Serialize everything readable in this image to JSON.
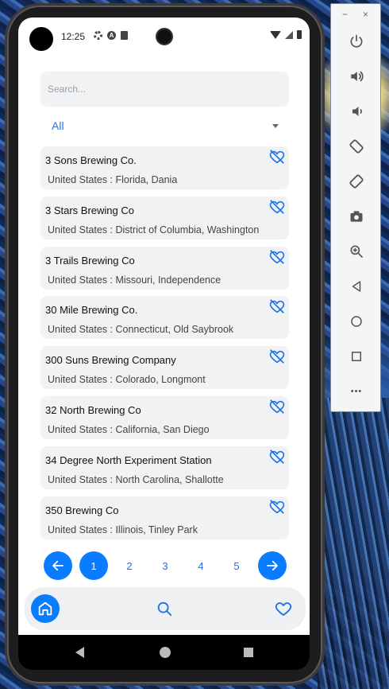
{
  "status": {
    "time": "12:25"
  },
  "search": {
    "placeholder": "Search..."
  },
  "filter": {
    "selected": "All"
  },
  "breweries": [
    {
      "name": "3 Sons Brewing Co.",
      "location": "United States : Florida, Dania"
    },
    {
      "name": "3 Stars Brewing Co",
      "location": "United States : District of Columbia, Washington"
    },
    {
      "name": "3 Trails Brewing Co",
      "location": "United States : Missouri, Independence"
    },
    {
      "name": "30 Mile Brewing Co.",
      "location": "United States : Connecticut, Old Saybrook"
    },
    {
      "name": "300 Suns Brewing Company",
      "location": "United States : Colorado, Longmont"
    },
    {
      "name": "32 North Brewing Co",
      "location": "United States : California, San Diego"
    },
    {
      "name": "34 Degree North Experiment Station",
      "location": "United States : North Carolina, Shallotte"
    },
    {
      "name": "350 Brewing Co",
      "location": "United States : Illinois, Tinley Park"
    }
  ],
  "pagination": {
    "pages": [
      "1",
      "2",
      "3",
      "4",
      "5"
    ],
    "current": "1"
  },
  "colors": {
    "accent": "#0a7cff",
    "card": "#f1f2f3",
    "text": "#111111"
  },
  "icons": {
    "prev": "arrow-left-icon",
    "next": "arrow-right-icon",
    "favorite": "heart-off-icon",
    "home": "home-icon",
    "search": "search-icon",
    "favorites": "heart-icon"
  },
  "emulator": {
    "close": "×",
    "minimize": "−",
    "more": "•••"
  }
}
